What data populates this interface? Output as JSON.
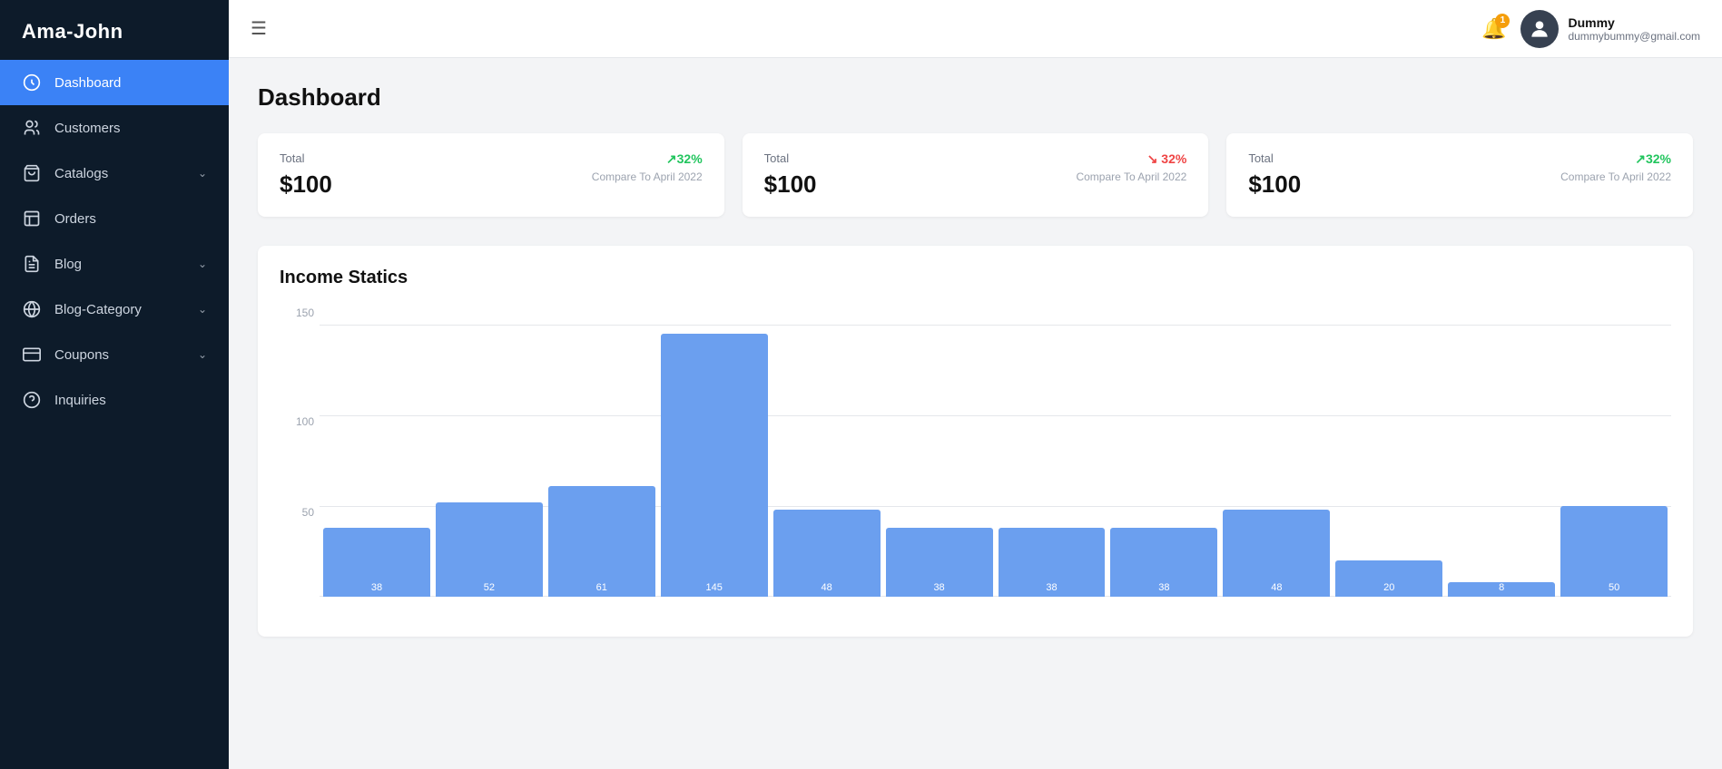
{
  "sidebar": {
    "logo": "Ama-John",
    "items": [
      {
        "id": "dashboard",
        "label": "Dashboard",
        "icon": "dashboard",
        "active": true,
        "hasArrow": false
      },
      {
        "id": "customers",
        "label": "Customers",
        "icon": "customers",
        "active": false,
        "hasArrow": false
      },
      {
        "id": "catalogs",
        "label": "Catalogs",
        "icon": "catalogs",
        "active": false,
        "hasArrow": true
      },
      {
        "id": "orders",
        "label": "Orders",
        "icon": "orders",
        "active": false,
        "hasArrow": false
      },
      {
        "id": "blog",
        "label": "Blog",
        "icon": "blog",
        "active": false,
        "hasArrow": true
      },
      {
        "id": "blog-category",
        "label": "Blog-Category",
        "icon": "blog-category",
        "active": false,
        "hasArrow": true
      },
      {
        "id": "coupons",
        "label": "Coupons",
        "icon": "coupons",
        "active": false,
        "hasArrow": true
      },
      {
        "id": "inquiries",
        "label": "Inquiries",
        "icon": "inquiries",
        "active": false,
        "hasArrow": false
      }
    ]
  },
  "header": {
    "hamburger_label": "☰",
    "notification_count": "1",
    "user": {
      "name": "Dummy",
      "email": "dummybummy@gmail.com"
    }
  },
  "page": {
    "title": "Dashboard"
  },
  "stats": [
    {
      "label": "Total",
      "value": "$100",
      "pct": "↗32%",
      "pct_direction": "up",
      "compare": "Compare To April 2022"
    },
    {
      "label": "Total",
      "value": "$100",
      "pct": "↘ 32%",
      "pct_direction": "down",
      "compare": "Compare To April 2022"
    },
    {
      "label": "Total",
      "value": "$100",
      "pct": "↗32%",
      "pct_direction": "up",
      "compare": "Compare To April 2022"
    }
  ],
  "chart": {
    "title": "Income Statics",
    "y_labels": [
      "150",
      "100",
      "50"
    ],
    "max_value": 160,
    "bars": [
      {
        "value": 38,
        "label": "38"
      },
      {
        "value": 52,
        "label": "52"
      },
      {
        "value": 61,
        "label": "61"
      },
      {
        "value": 145,
        "label": "145"
      },
      {
        "value": 48,
        "label": "48"
      },
      {
        "value": 38,
        "label": "38"
      },
      {
        "value": 38,
        "label": "38"
      },
      {
        "value": 38,
        "label": "38"
      },
      {
        "value": 48,
        "label": "48"
      },
      {
        "value": 20,
        "label": "20"
      },
      {
        "value": 8,
        "label": "8"
      },
      {
        "value": 50,
        "label": "50"
      }
    ]
  }
}
